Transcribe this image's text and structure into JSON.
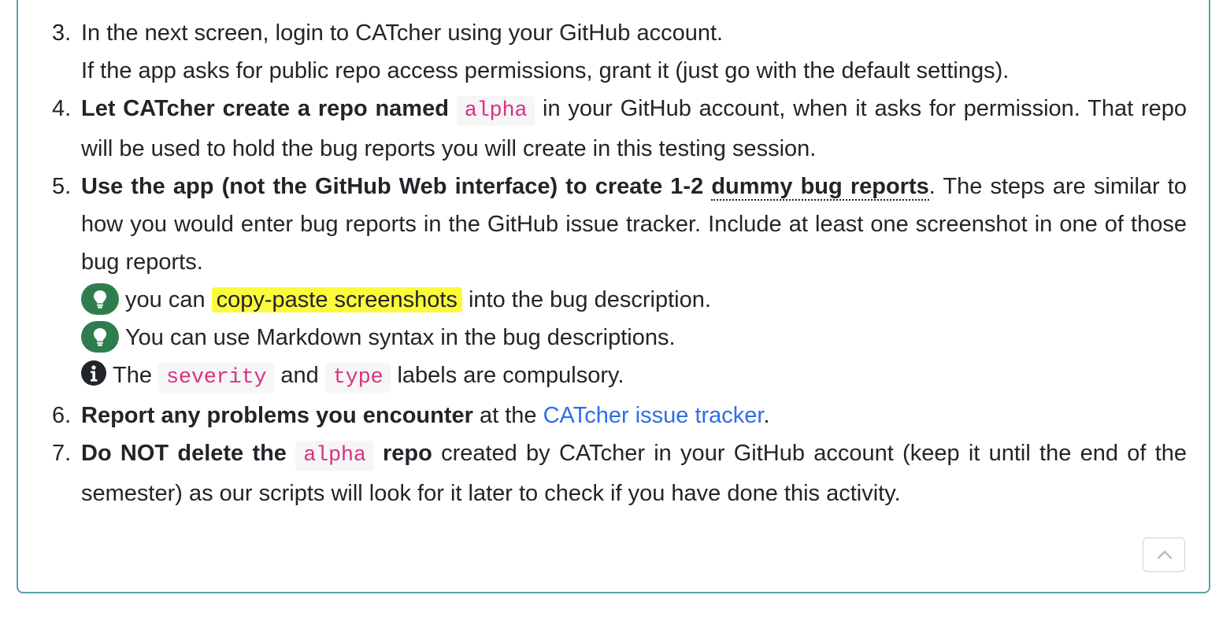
{
  "steps": [
    {
      "num": "3.",
      "t1": "In the next screen, login to CATcher using your GitHub account.",
      "t2": "If the app asks for public repo access permissions, grant it (just go with the default settings)."
    },
    {
      "num": "4.",
      "b1": "Let CATcher create a repo named",
      "code": "alpha",
      "t1": " in your GitHub account, when it asks for permission. That repo will be used to hold the bug reports you will create in this testing session."
    },
    {
      "num": "5.",
      "b1": "Use the app (not the GitHub Web interface) to create 1-2 ",
      "b2": "dummy bug reports",
      "t1": ". The steps are similar to how you would enter bug reports in the GitHub issue tracker. Include at least one screenshot in one of those bug reports.",
      "tip1_pre": "you can ",
      "tip1_hl": "copy-paste screenshots",
      "tip1_post": " into the bug description.",
      "tip2": "You can use Markdown syntax in the bug descriptions.",
      "info_pre": "The ",
      "info_code1": "severity",
      "info_mid": " and ",
      "info_code2": "type",
      "info_post": " labels are compulsory."
    },
    {
      "num": "6.",
      "b1": "Report any problems you encounter",
      "t1": " at the ",
      "link": "CATcher issue tracker",
      "t2": "."
    },
    {
      "num": "7.",
      "b1": "Do NOT delete the ",
      "code": "alpha",
      "b2": " repo",
      "t1": " created by CATcher in your GitHub account (keep it until the end of the semester) as our scripts will look for it later to check if you have done this activity."
    }
  ],
  "icons": {
    "tip": "lightbulb-icon",
    "info": "info-circle-icon",
    "scroll_top": "chevron-up-icon"
  },
  "colors": {
    "tip_badge": "#2e7d4e",
    "highlight": "#fbfb3c",
    "link": "#2d6ee9",
    "code": "#d63384",
    "panel_border": "#5aa2a8"
  }
}
